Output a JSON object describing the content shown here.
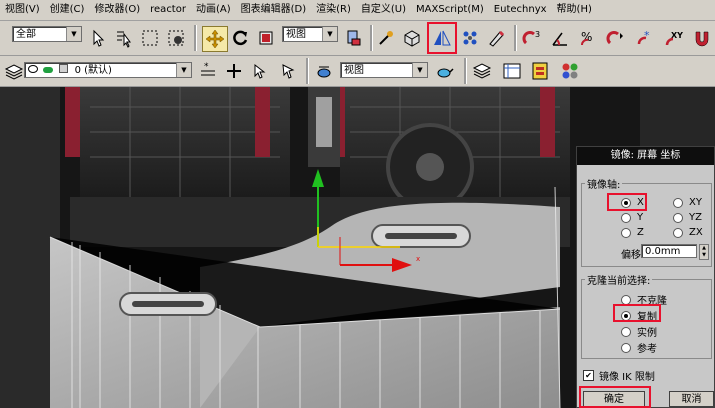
{
  "menu": [
    "视图(V)",
    "创建(C)",
    "修改器(O)",
    "reactor",
    "动画(A)",
    "图表编辑器(D)",
    "渲染(R)",
    "自定义(U)",
    "MAXScript(M)",
    "Eutechnyx",
    "帮助(H)"
  ],
  "toolbar1": {
    "selection_filter": "全部",
    "ref_coord": "视图"
  },
  "toolbar2": {
    "layer_name": "0 (默认)",
    "view_select": "视图"
  },
  "dialog": {
    "title": "镜像: 屏幕 坐标",
    "mirror_axis_label": "镜像轴:",
    "axes": [
      {
        "label": "X",
        "selected": true
      },
      {
        "label": "XY",
        "selected": false
      },
      {
        "label": "Y",
        "selected": false
      },
      {
        "label": "YZ",
        "selected": false
      },
      {
        "label": "Z",
        "selected": false
      },
      {
        "label": "ZX",
        "selected": false
      }
    ],
    "offset_label": "偏移:",
    "offset_value": "0.0mm",
    "clone_label": "克隆当前选择:",
    "clone_options": [
      {
        "label": "不克隆",
        "selected": false
      },
      {
        "label": "复制",
        "selected": true
      },
      {
        "label": "实例",
        "selected": false
      },
      {
        "label": "参考",
        "selected": false
      }
    ],
    "ik_label": "镜像 IK 限制",
    "ok_label": "确定",
    "cancel_label": "取消"
  },
  "colors": {
    "highlight": "#e8112d",
    "ui_gray": "#d4d0c8",
    "dialog_title": "#0e0e0e"
  }
}
